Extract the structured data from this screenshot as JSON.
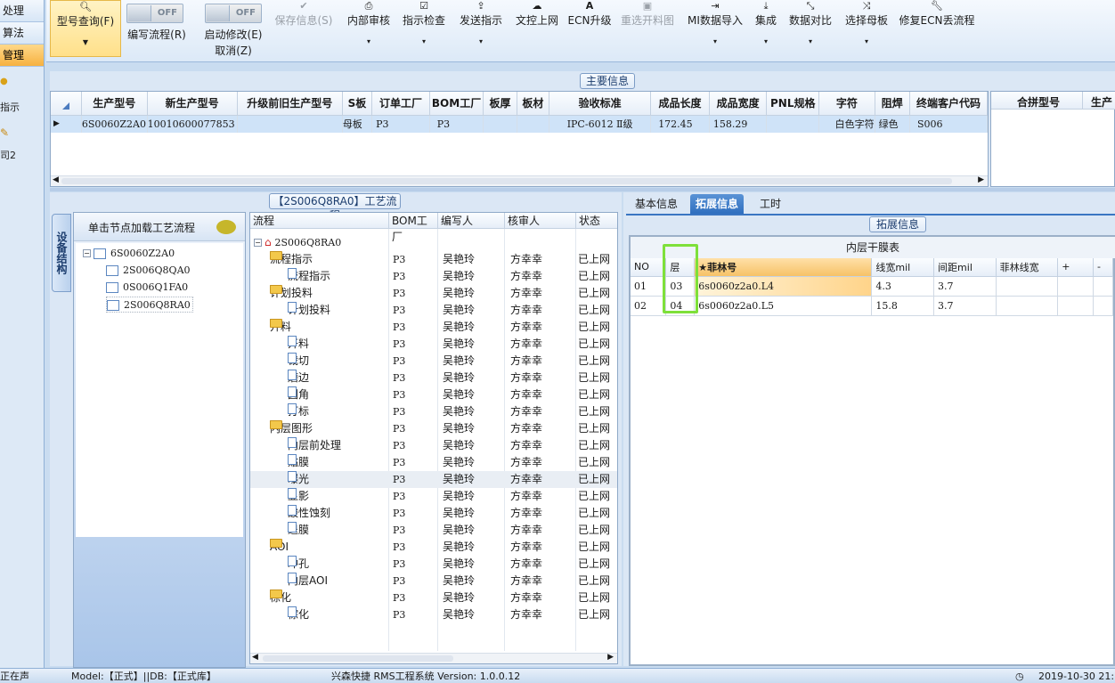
{
  "sidebar": {
    "items": [
      {
        "label": "处理"
      },
      {
        "label": "算法"
      },
      {
        "label": "管理"
      }
    ],
    "small_items": [
      {
        "label": "指示"
      },
      {
        "label": "司2"
      }
    ]
  },
  "toolbar": {
    "buttons": [
      {
        "label": "型号查询(F)",
        "icon": "search-icon"
      },
      {
        "label": "编写流程(R)",
        "toggle": "OFF"
      },
      {
        "label": "启动修改(E)",
        "toggle": "OFF",
        "sublabel": "取消(Z)"
      },
      {
        "label": "保存信息(S)",
        "icon": "check-icon"
      },
      {
        "label": "内部审核",
        "icon": "print-icon"
      },
      {
        "label": "指示检查",
        "icon": "checkbox-icon"
      },
      {
        "label": "发送指示",
        "icon": "upload-icon"
      },
      {
        "label": "文控上网",
        "icon": "cloud-upload-icon"
      },
      {
        "label": "ECN升级",
        "icon": "letter-a-icon"
      },
      {
        "label": "重选开料图",
        "icon": "image-icon"
      },
      {
        "label": "MI数据导入",
        "icon": "import-icon"
      },
      {
        "label": "集成",
        "icon": "download-icon"
      },
      {
        "label": "数据对比",
        "icon": "compare-icon"
      },
      {
        "label": "选择母板",
        "icon": "shuffle-icon"
      },
      {
        "label": "修复ECN丢流程",
        "icon": "wrench-icon"
      }
    ]
  },
  "main_info": {
    "title": "主要信息",
    "columns": [
      "生产型号",
      "新生产型号",
      "升级前旧生产型号",
      "S板",
      "订单工厂",
      "BOM工厂",
      "板厚",
      "板材",
      "验收标准",
      "成品长度",
      "成品宽度",
      "PNL规格",
      "字符",
      "阻焊",
      "终端客户代码"
    ],
    "rows": [
      [
        "6S0060Z2A0",
        "10010600077853",
        "",
        "母板",
        "P3",
        "P3",
        "",
        "",
        "IPC-6012 Ⅱ级",
        "172.45",
        "158.29",
        "",
        "白色字符",
        "绿色",
        "S006"
      ]
    ],
    "side_columns": [
      "合拼型号",
      "生产"
    ]
  },
  "left_tree": {
    "vertical_tab": "设备结构",
    "header": "单击节点加载工艺流程",
    "root": "6S0060Z2A0",
    "children": [
      "2S006Q8QA0",
      "0S006Q1FA0",
      "2S006Q8RA0"
    ]
  },
  "flow": {
    "title": "【2S006Q8RA0】工艺流程",
    "columns": [
      "流程",
      "BOM工厂",
      "编写人",
      "核审人",
      "状态"
    ],
    "root": "2S006Q8RA0",
    "rows": [
      {
        "name": "流程指示",
        "level": 1,
        "type": "folder",
        "bom": "P3",
        "writer": "吴艳玲",
        "reviewer": "方幸幸",
        "status": "已上网"
      },
      {
        "name": "流程指示",
        "level": 2,
        "type": "doc",
        "bom": "P3",
        "writer": "吴艳玲",
        "reviewer": "方幸幸",
        "status": "已上网"
      },
      {
        "name": "计划投料",
        "level": 1,
        "type": "folder",
        "bom": "P3",
        "writer": "吴艳玲",
        "reviewer": "方幸幸",
        "status": "已上网"
      },
      {
        "name": "计划投料",
        "level": 2,
        "type": "doc",
        "bom": "P3",
        "writer": "吴艳玲",
        "reviewer": "方幸幸",
        "status": "已上网"
      },
      {
        "name": "开料",
        "level": 1,
        "type": "folder",
        "bom": "P3",
        "writer": "吴艳玲",
        "reviewer": "方幸幸",
        "status": "已上网"
      },
      {
        "name": "开料",
        "level": 2,
        "type": "doc",
        "bom": "P3",
        "writer": "吴艳玲",
        "reviewer": "方幸幸",
        "status": "已上网"
      },
      {
        "name": "裁切",
        "level": 2,
        "type": "doc",
        "bom": "P3",
        "writer": "吴艳玲",
        "reviewer": "方幸幸",
        "status": "已上网"
      },
      {
        "name": "磨边",
        "level": 2,
        "type": "doc",
        "bom": "P3",
        "writer": "吴艳玲",
        "reviewer": "方幸幸",
        "status": "已上网"
      },
      {
        "name": "圆角",
        "level": 2,
        "type": "doc",
        "bom": "P3",
        "writer": "吴艳玲",
        "reviewer": "方幸幸",
        "status": "已上网"
      },
      {
        "name": "打标",
        "level": 2,
        "type": "doc",
        "bom": "P3",
        "writer": "吴艳玲",
        "reviewer": "方幸幸",
        "status": "已上网"
      },
      {
        "name": "内层图形",
        "level": 1,
        "type": "folder",
        "bom": "P3",
        "writer": "吴艳玲",
        "reviewer": "方幸幸",
        "status": "已上网"
      },
      {
        "name": "内层前处理",
        "level": 2,
        "type": "doc",
        "bom": "P3",
        "writer": "吴艳玲",
        "reviewer": "方幸幸",
        "status": "已上网"
      },
      {
        "name": "贴膜",
        "level": 2,
        "type": "doc",
        "bom": "P3",
        "writer": "吴艳玲",
        "reviewer": "方幸幸",
        "status": "已上网"
      },
      {
        "name": "曝光",
        "level": 2,
        "type": "doc",
        "bom": "P3",
        "writer": "吴艳玲",
        "reviewer": "方幸幸",
        "status": "已上网",
        "selected": true
      },
      {
        "name": "显影",
        "level": 2,
        "type": "doc",
        "bom": "P3",
        "writer": "吴艳玲",
        "reviewer": "方幸幸",
        "status": "已上网"
      },
      {
        "name": "酸性蚀刻",
        "level": 2,
        "type": "doc",
        "bom": "P3",
        "writer": "吴艳玲",
        "reviewer": "方幸幸",
        "status": "已上网"
      },
      {
        "name": "退膜",
        "level": 2,
        "type": "doc",
        "bom": "P3",
        "writer": "吴艳玲",
        "reviewer": "方幸幸",
        "status": "已上网"
      },
      {
        "name": "AOI",
        "level": 1,
        "type": "folder",
        "bom": "P3",
        "writer": "吴艳玲",
        "reviewer": "方幸幸",
        "status": "已上网"
      },
      {
        "name": "冲孔",
        "level": 2,
        "type": "doc",
        "bom": "P3",
        "writer": "吴艳玲",
        "reviewer": "方幸幸",
        "status": "已上网"
      },
      {
        "name": "内层AOI",
        "level": 2,
        "type": "doc",
        "bom": "P3",
        "writer": "吴艳玲",
        "reviewer": "方幸幸",
        "status": "已上网"
      },
      {
        "name": "棕化",
        "level": 1,
        "type": "folder",
        "bom": "P3",
        "writer": "吴艳玲",
        "reviewer": "方幸幸",
        "status": "已上网"
      },
      {
        "name": "棕化",
        "level": 2,
        "type": "doc",
        "bom": "P3",
        "writer": "吴艳玲",
        "reviewer": "方幸幸",
        "status": "已上网"
      }
    ]
  },
  "right_panel": {
    "tabs": [
      "基本信息",
      "拓展信息",
      "工时"
    ],
    "active_tab": "拓展信息",
    "section_title": "拓展信息",
    "table_title": "内层干膜表",
    "columns": [
      "NO",
      "层",
      "★菲林号",
      "线宽mil",
      "间距mil",
      "菲林线宽",
      "+",
      "-"
    ],
    "rows": [
      [
        "01",
        "03",
        "6s0060z2a0.L4",
        "4.3",
        "3.7",
        "",
        "",
        ""
      ],
      [
        "02",
        "04",
        "6s0060z2a0.L5",
        "15.8",
        "3.7",
        "",
        "",
        ""
      ]
    ],
    "highlight_color": "#7ee03a"
  },
  "statusbar": {
    "left": "正在声",
    "model": "Model:【正式】||DB:【正式库】",
    "app": "兴森快捷 RMS工程系统 Version: 1.0.0.12",
    "time": "2019-10-30 21:"
  }
}
